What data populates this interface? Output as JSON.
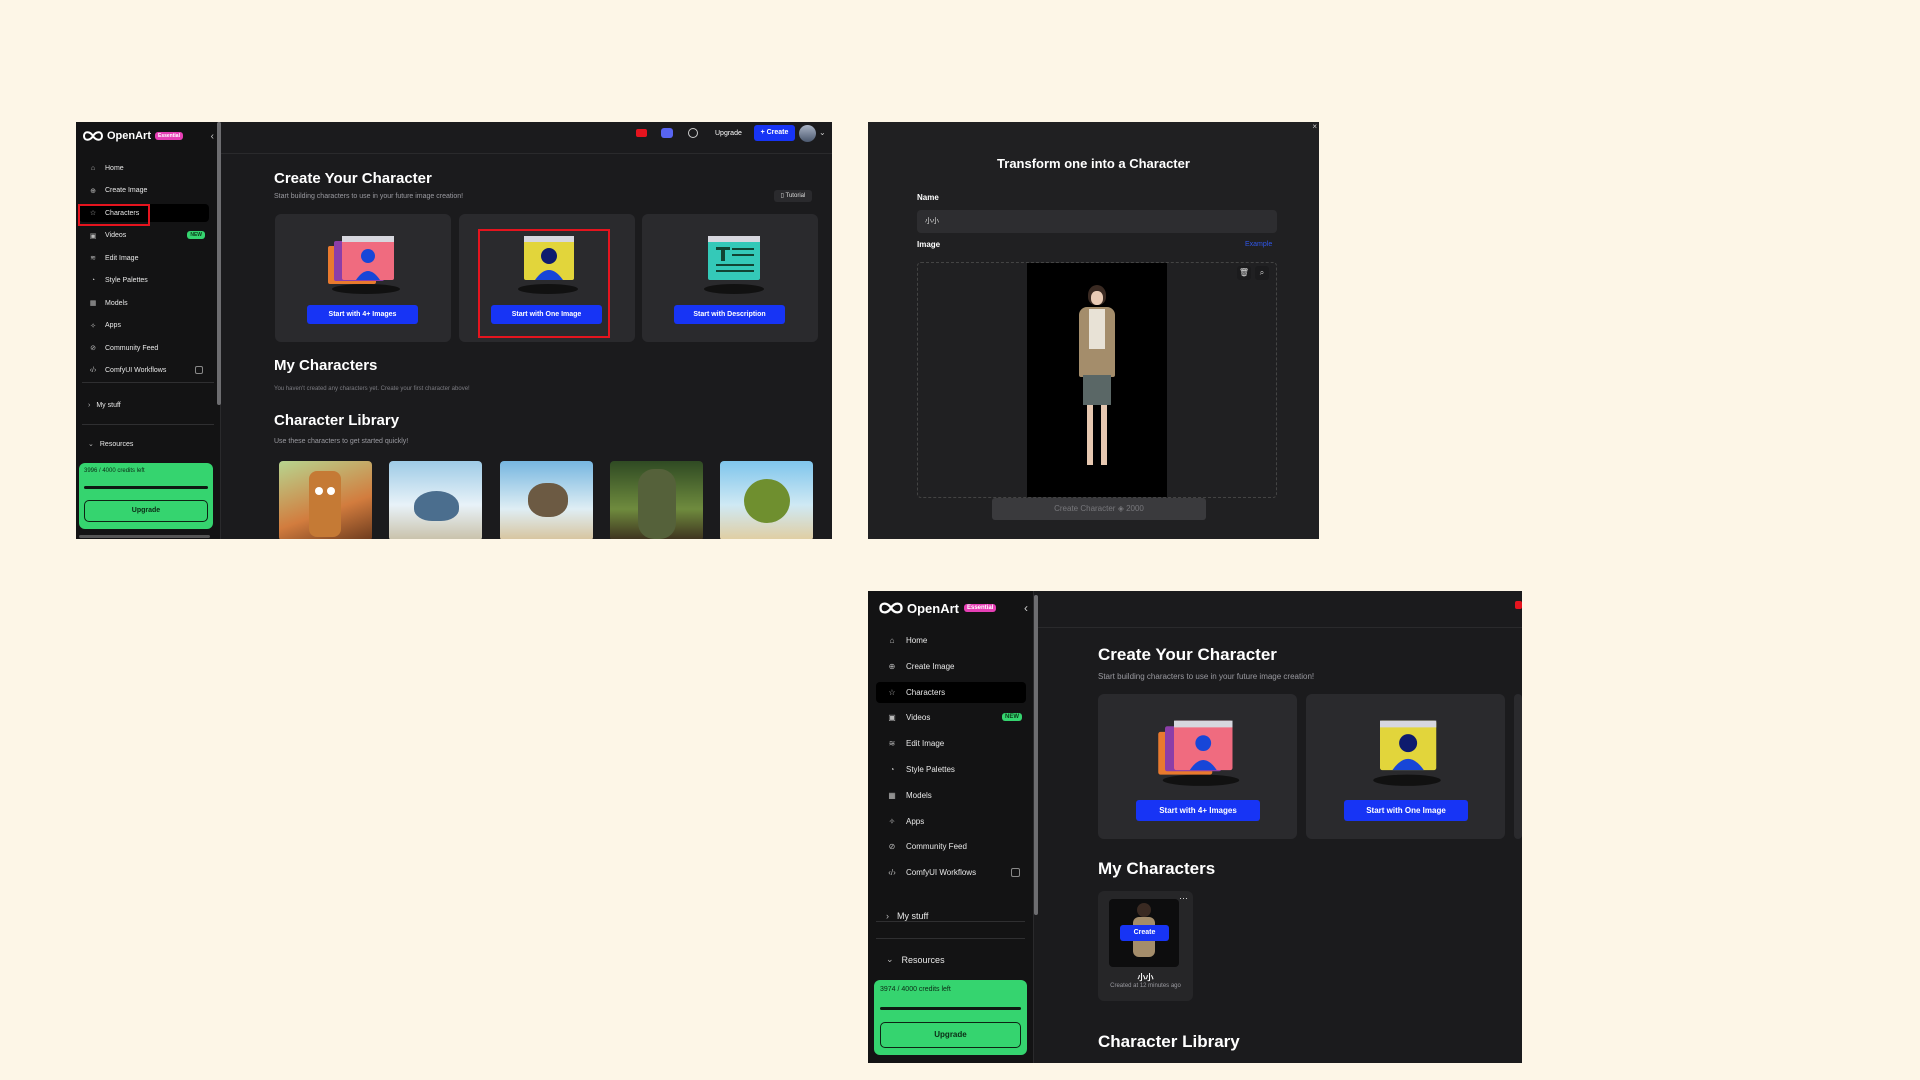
{
  "brand": {
    "name": "OpenArt",
    "badge": "Essential"
  },
  "nav": [
    {
      "label": "Home",
      "icon": "home-icon"
    },
    {
      "label": "Create Image",
      "icon": "plus-circle-icon"
    },
    {
      "label": "Characters",
      "icon": "star-icon"
    },
    {
      "label": "Videos",
      "icon": "video-icon",
      "badge": "NEW"
    },
    {
      "label": "Edit Image",
      "icon": "layers-icon"
    },
    {
      "label": "Style Palettes",
      "icon": "palette-icon"
    },
    {
      "label": "Models",
      "icon": "grid-icon"
    },
    {
      "label": "Apps",
      "icon": "sparkle-icon"
    },
    {
      "label": "Community Feed",
      "icon": "compass-icon"
    },
    {
      "label": "ComfyUI Workflows",
      "icon": "code-icon"
    }
  ],
  "sections": {
    "my_stuff": "My stuff",
    "resources": "Resources"
  },
  "shot1": {
    "credits": "3996 / 4000 credits left",
    "credits_fraction": 0.999,
    "upgrade": "Upgrade",
    "topbar": {
      "upgrade": "Upgrade",
      "create": "+ Create"
    },
    "title": "Create Your Character",
    "subtitle": "Start building characters to use in your future image creation!",
    "tutorial": "Tutorial",
    "buttons": [
      "Start with 4+ Images",
      "Start with One Image",
      "Start with Description"
    ],
    "my_chars_title": "My Characters",
    "my_chars_empty": "You haven't created any characters yet. Create your first character above!",
    "lib_title": "Character Library",
    "lib_sub": "Use these characters to get started quickly!"
  },
  "shot2": {
    "title": "Transform one into a Character",
    "name_label": "Name",
    "name_value": "小小",
    "image_label": "Image",
    "example": "Example",
    "create_btn": "Create Character",
    "cost": "2000"
  },
  "shot3": {
    "credits": "3974 / 4000 credits left",
    "credits_fraction": 0.9935,
    "upgrade": "Upgrade",
    "title": "Create Your Character",
    "subtitle": "Start building characters to use in your future image creation!",
    "buttons": [
      "Start with 4+ Images",
      "Start with One Image"
    ],
    "my_chars_title": "My Characters",
    "char_name": "小小",
    "char_create": "Create",
    "char_time": "Created at 12 minutes ago",
    "lib_title": "Character Library"
  },
  "colors": {
    "accent_blue": "#1734f5",
    "credit_green": "#35d46f",
    "badge_pink": "#e63fb5",
    "highlight_red": "#e5141e"
  }
}
